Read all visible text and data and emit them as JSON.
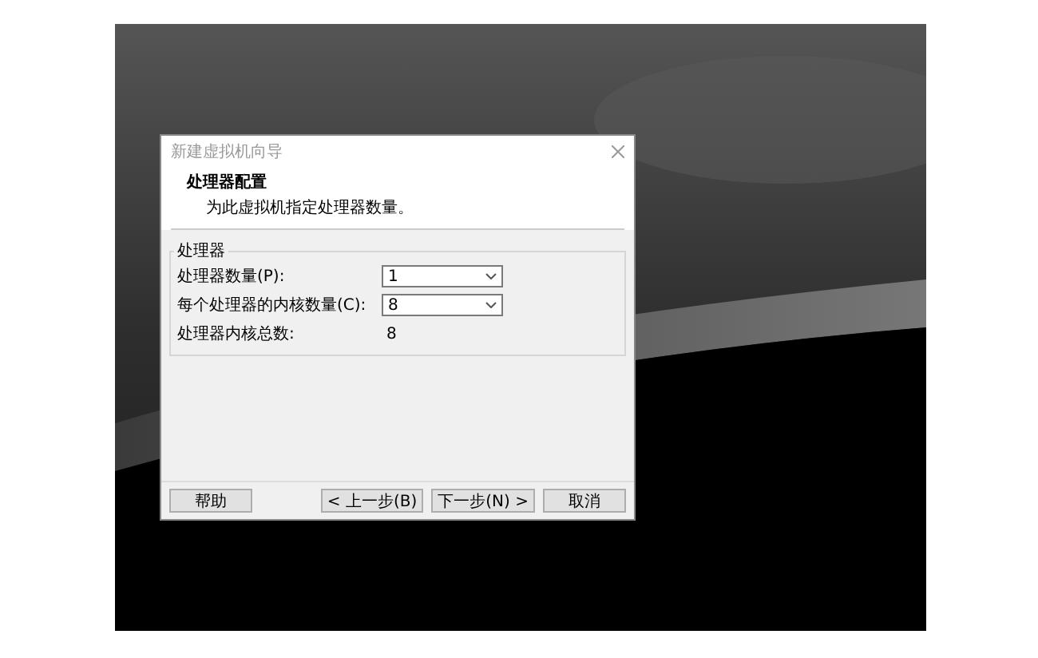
{
  "window": {
    "title": "新建虚拟机向导"
  },
  "header": {
    "title": "处理器配置",
    "subtitle": "为此虚拟机指定处理器数量。"
  },
  "group": {
    "label": "处理器",
    "fields": [
      {
        "kind": "select",
        "label": "处理器数量(P):",
        "value": "1"
      },
      {
        "kind": "select",
        "label": "每个处理器的内核数量(C):",
        "value": "8"
      },
      {
        "kind": "readout",
        "label": "处理器内核总数:",
        "value": "8"
      }
    ]
  },
  "buttons": [
    {
      "label": "帮助"
    },
    {
      "label": "< 上一步(B)"
    },
    {
      "label": "下一步(N) >"
    },
    {
      "label": "取消"
    }
  ]
}
